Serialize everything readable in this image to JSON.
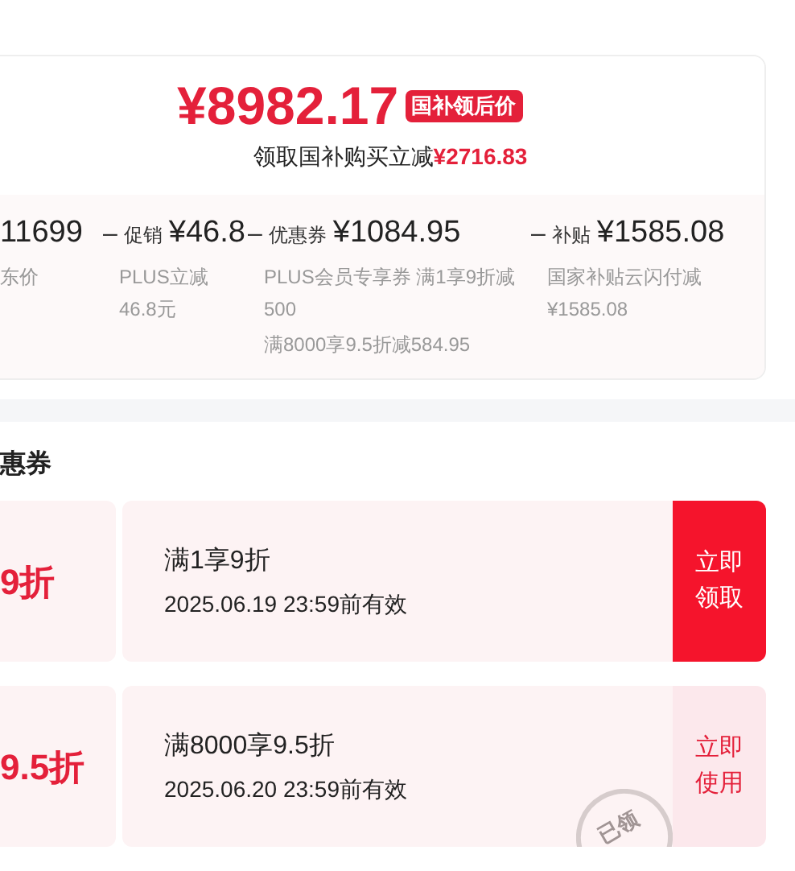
{
  "price": {
    "amount": "¥8982.17",
    "badge": "国补领后价",
    "saving_label": "领取国补购买立减",
    "saving_amount": "¥2716.83"
  },
  "breakdown": [
    {
      "amount": "11699",
      "notes": [
        "东价"
      ]
    },
    {
      "operator": "–",
      "label": "促销",
      "amount": "¥46.8",
      "notes": [
        "PLUS立减46.8元"
      ]
    },
    {
      "operator": "–",
      "label": "优惠券",
      "amount": "¥1084.95",
      "notes": [
        "PLUS会员专享券 满1享9折减500",
        "满8000享9.5折减584.95"
      ]
    },
    {
      "operator": "–",
      "label": "补贴",
      "amount": "¥1585.08",
      "notes": [
        "国家补贴云闪付减¥1585.08"
      ]
    }
  ],
  "section_title": "惠券",
  "coupons": [
    {
      "value": "9折",
      "title": "满1享9折",
      "validity": "2025.06.19 23:59前有效",
      "action": "立即领取",
      "claimed": false
    },
    {
      "value": "9.5折",
      "title": "满8000享9.5折",
      "validity": "2025.06.20 23:59前有效",
      "action": "立即使用",
      "claimed": true,
      "stamp": "已领"
    }
  ]
}
